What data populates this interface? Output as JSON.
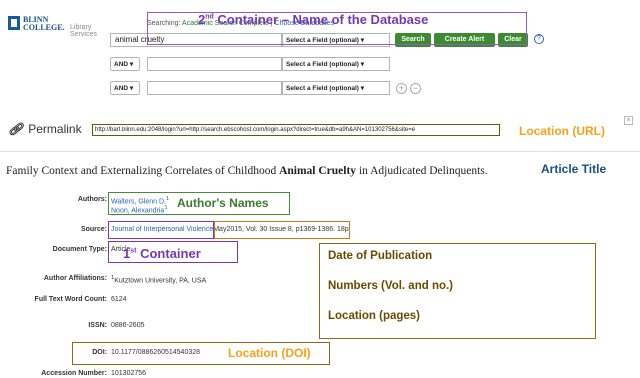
{
  "logo": {
    "line1": "BLINN",
    "line2": "COLLEGE.",
    "service": "Library Services"
  },
  "search": {
    "searching_label": "Searching:",
    "database": "Academic Search Complete",
    "choose": "Choose Databases",
    "query": "animal cruelty",
    "field_label": "Select a Field (optional)",
    "bool_label": "AND",
    "search_button": "Search",
    "alert_button": "Create Alert",
    "clear_button": "Clear",
    "add_row": "+",
    "remove_row": "−",
    "help": "?"
  },
  "annotations": {
    "database": {
      "super": "nd",
      "prefix": "2",
      "text": "Container – Name of the Database"
    },
    "url": "Location (URL)",
    "title": "Article Title",
    "authors": "Author's Names",
    "container1": {
      "prefix": "1",
      "super": "st",
      "text": "Container"
    },
    "info_lines": [
      "Date of Publication",
      "Numbers (Vol. and no.)",
      "Location (pages)"
    ],
    "doi": "Location (DOI)"
  },
  "permalink": {
    "label": "Permalink",
    "url": "http://bart.blinn.edu:2048/login?url=http://search.ebscohost.com/login.aspx?direct=true&db=a9h&AN=101302756&site=e"
  },
  "article": {
    "title_pre": "Family Context and Externalizing Correlates of Childhood ",
    "title_bold": "Animal Cruelty",
    "title_post": " in Adjudicated Delinquents."
  },
  "record": {
    "authors_label": "Authors:",
    "authors": [
      "Walters, Glenn D.",
      "Noon, Alexandria"
    ],
    "author_sup": "1",
    "source_label": "Source:",
    "journal": "Journal of Interpersonal Violence",
    "source_detail": "May2015, Vol. 30 Issue 8, p1369-1386. 18p.",
    "doctype_label": "Document Type:",
    "doctype": "Article",
    "affil_label": "Author Affiliations:",
    "affil_sup": "1",
    "affil": "Kutztown University, PA, USA",
    "wordcount_label": "Full Text Word Count:",
    "wordcount": "6124",
    "issn_label": "ISSN:",
    "issn": "0886-2605",
    "doi_label": "DOI:",
    "doi": "10.1177/0886260514540328",
    "accession_label": "Accession Number:",
    "accession": "101302756"
  },
  "colors": {
    "button": "#3d8a32",
    "link": "#2a62b8",
    "db_annotation": "#7a36b2",
    "orange": "#f5a21a"
  }
}
